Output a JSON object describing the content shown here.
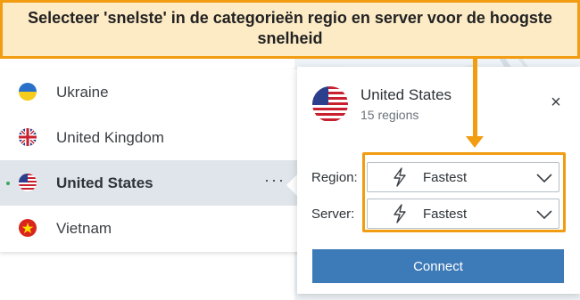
{
  "annotation": {
    "text": "Selecteer 'snelste' in de categorieën regio en server voor de hoogste snelheid"
  },
  "countries": [
    {
      "name": "Ukraine",
      "flag": "ukraine-flag-icon",
      "selected": false
    },
    {
      "name": "United Kingdom",
      "flag": "uk-flag-icon",
      "selected": false
    },
    {
      "name": "United States",
      "flag": "us-flag-icon",
      "selected": true
    },
    {
      "name": "Vietnam",
      "flag": "vietnam-flag-icon",
      "selected": false
    }
  ],
  "more_options": "···",
  "popup": {
    "country": "United States",
    "regions": "15 regions",
    "close_symbol": "×",
    "region_label": "Region:",
    "region_value": "Fastest",
    "server_label": "Server:",
    "server_value": "Fastest",
    "connect_label": "Connect"
  },
  "colors": {
    "highlight": "#f29c11",
    "banner_bg": "#fdebc6",
    "connect_bg": "#3d7ab8",
    "selected_row": "#dfe5ea",
    "online": "#3aa757"
  }
}
